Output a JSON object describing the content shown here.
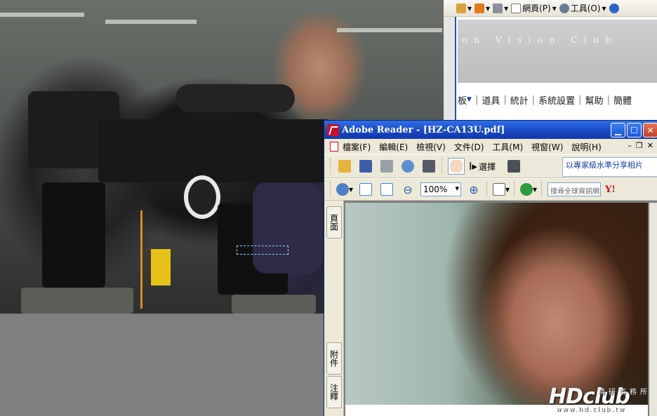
{
  "browser": {
    "toolbar": {
      "page_menu": "網頁(P)",
      "tools_menu": "工具(O)"
    },
    "banner_text": "on Vision Club",
    "menu": {
      "partial": "板",
      "items": [
        "道具",
        "統計",
        "系統設置",
        "幫助",
        "簡體"
      ]
    }
  },
  "reader": {
    "title": "Adobe Reader - [HZ-CA13U.pdf]",
    "menu": [
      "檔案(F)",
      "編輯(E)",
      "檢視(V)",
      "文件(D)",
      "工具(M)",
      "視窗(W)",
      "說明(H)"
    ],
    "toolbar": {
      "select_label": "選擇",
      "ad_text": "以專家級水準分享相片",
      "zoom_value": "100%",
      "search_placeholder": "搜尋全球資訊網",
      "yahoo_label": "Y!"
    },
    "side_tabs": {
      "pages": "頁面",
      "attachments": "附件",
      "comments": "注釋"
    }
  },
  "watermark": {
    "hd": "HDclub",
    "chinese": "精研事務所",
    "url": "www.hd.club.tw"
  },
  "colors": {
    "title_bar": "#1746c0",
    "adobe_red": "#c8102e",
    "toolbar_bg": "#ece9d8"
  }
}
